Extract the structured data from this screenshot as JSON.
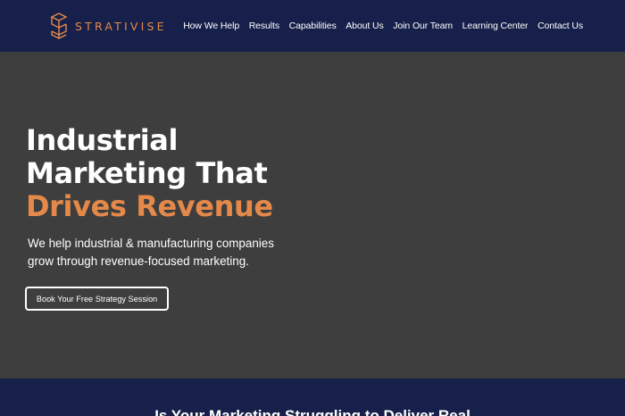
{
  "brand": {
    "name": "STRATIVISE",
    "logo_icon": "stacked-s-cube-icon",
    "accent_color": "#e5894a",
    "nav_bg_color": "#16204a"
  },
  "nav": {
    "items": [
      {
        "label": "How We Help"
      },
      {
        "label": "Results"
      },
      {
        "label": "Capabilities"
      },
      {
        "label": "About Us"
      },
      {
        "label": "Join Our Team"
      },
      {
        "label": "Learning Center"
      },
      {
        "label": "Contact Us"
      }
    ]
  },
  "hero": {
    "heading_line1": "Industrial",
    "heading_line2": "Marketing That",
    "heading_accent": "Drives Revenue",
    "subtext_line1": "We help industrial & manufacturing companies",
    "subtext_line2": "grow through revenue-focused marketing.",
    "cta_label": "Book Your Free Strategy Session",
    "bg_color": "#3e3e3e"
  },
  "section2": {
    "title": "Is Your Marketing Struggling to Deliver Real"
  }
}
